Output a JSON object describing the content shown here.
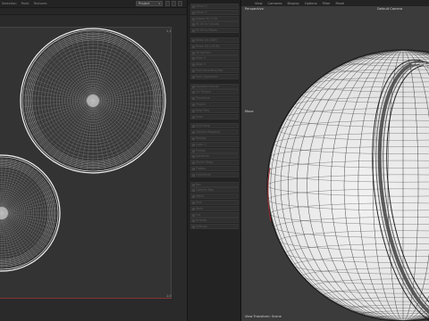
{
  "uv_editor": {
    "menu": [
      "Selection",
      "Paint",
      "Textures"
    ],
    "project_select": "Project",
    "corner_top": "1,1",
    "corner_bottom": "1,0"
  },
  "uv_command_panel": {
    "items": [
      "Mirror U",
      "Mirror V",
      "Rotate 90 CCW",
      "Fit UV to Canvas",
      "Fit UV to Points",
      "Relax UV (ABF)",
      "Relax UV (LSCM)",
      "Straighten",
      "Align U",
      "Align V",
      "Pack Bounding Box",
      "Pack Geometric",
      "Equalize Islands",
      "UV Terrace",
      "Transform",
      "Project",
      "Map Tiles",
      "Snap",
      "Grid Snap",
      "Optimal Mapping",
      "Realign",
      "Cubic 2",
      "Frontal",
      "Spherical",
      "Shrink Wrap",
      "Flatten",
      "Cylindrical",
      "Box",
      "Camera Map",
      "Stitch",
      "Sew",
      "Weld",
      "Cut",
      "Unwrap",
      "Settings"
    ]
  },
  "viewport": {
    "menu": [
      "View",
      "Cameras",
      "Display",
      "Options",
      "Filter",
      "Panel"
    ],
    "label_perspective": "Perspective",
    "label_camera": "Default Camera",
    "label_move": "Move",
    "status": "View Transform: Scene"
  },
  "colors": {
    "uv_background": "#333333",
    "wire": "#d8d8d8",
    "ball_shade": "#e8e8e8",
    "viewport_background": "#3b3b3b",
    "seam_highlight": "#9b2d2d"
  }
}
